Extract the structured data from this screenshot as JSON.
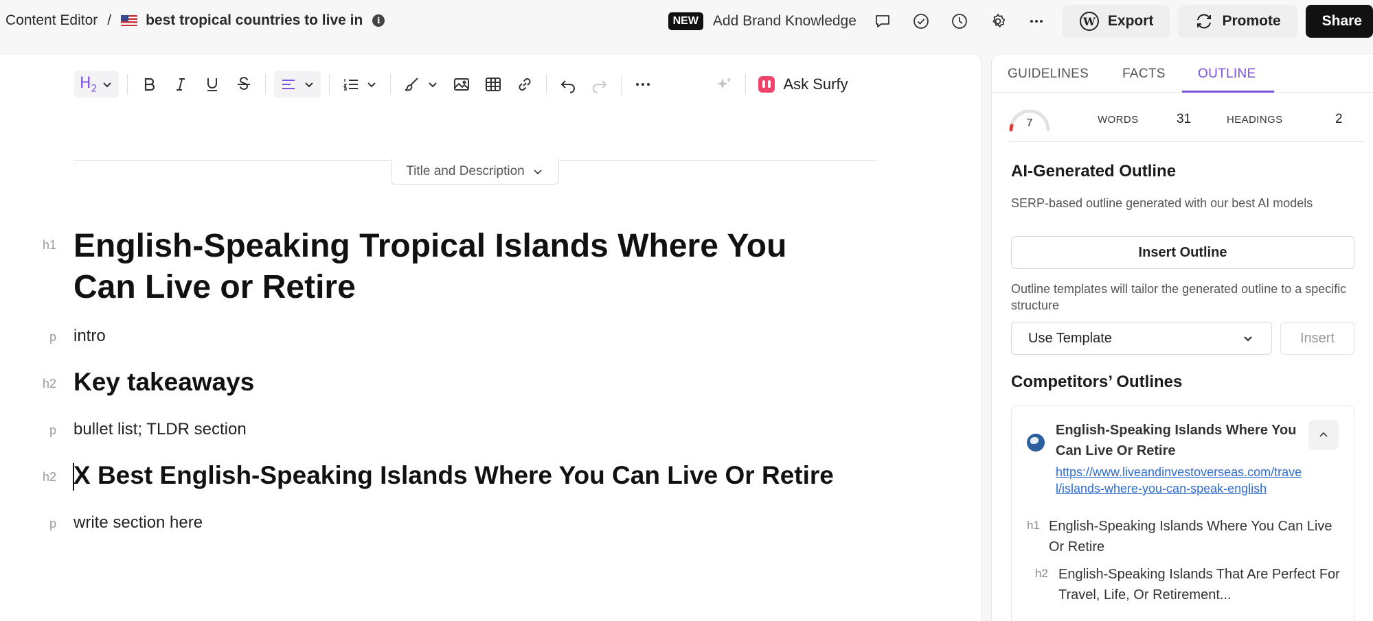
{
  "breadcrumb": {
    "root": "Content Editor",
    "separator": "/",
    "document": "best tropical countries to live in"
  },
  "header": {
    "new_badge": "NEW",
    "brand_knowledge": "Add Brand Knowledge",
    "export_label": "Export",
    "promote_label": "Promote",
    "share_label": "Share",
    "icons": [
      "comment-icon",
      "check-circle-icon",
      "history-icon",
      "gear-icon",
      "more-icon"
    ]
  },
  "toolbar": {
    "heading_level": "H",
    "heading_sub": "2",
    "ask_label": "Ask Surfy"
  },
  "title_description_label": "Title and Description",
  "document": {
    "blocks": [
      {
        "tag": "h1",
        "text": "English-Speaking Tropical Islands Where You Can Live or Retire"
      },
      {
        "tag": "p",
        "text": "intro"
      },
      {
        "tag": "h2",
        "text": "Key takeaways"
      },
      {
        "tag": "p",
        "text": "bullet list; TLDR section"
      },
      {
        "tag": "h2",
        "text": "X Best English-Speaking Islands Where You Can Live Or Retire"
      },
      {
        "tag": "p",
        "text": "write section here"
      }
    ]
  },
  "panel": {
    "tabs": [
      "GUIDELINES",
      "FACTS",
      "OUTLINE"
    ],
    "active_tab": "OUTLINE",
    "score": "7",
    "words_label": "WORDS",
    "words_value": "31",
    "headings_label": "HEADINGS",
    "headings_value": "2",
    "ai_outline_title": "AI-Generated Outline",
    "ai_outline_desc": "SERP-based outline generated with our best AI models",
    "insert_outline_label": "Insert Outline",
    "templates_desc": "Outline templates will tailor the generated outline to a specific structure",
    "template_select": "Use Template",
    "insert_label": "Insert",
    "competitors_title": "Competitors’ Outlines",
    "competitor": {
      "title": "English-Speaking Islands Where You Can Live Or Retire",
      "url": "https://www.liveandinvestoverseas.com/travel/islands-where-you-can-speak-english",
      "outline": [
        {
          "tag": "h1",
          "text": "English-Speaking Islands Where You Can Live Or Retire"
        },
        {
          "tag": "h2",
          "text": "English-Speaking Islands That Are Perfect For Travel, Life, Or Retirement..."
        }
      ]
    }
  },
  "colors": {
    "accent": "#7b4fe0",
    "link": "#2d6bd0",
    "dark_button": "#111111",
    "surfy": "#f0456b",
    "gauge_low": "#e03b3b"
  }
}
